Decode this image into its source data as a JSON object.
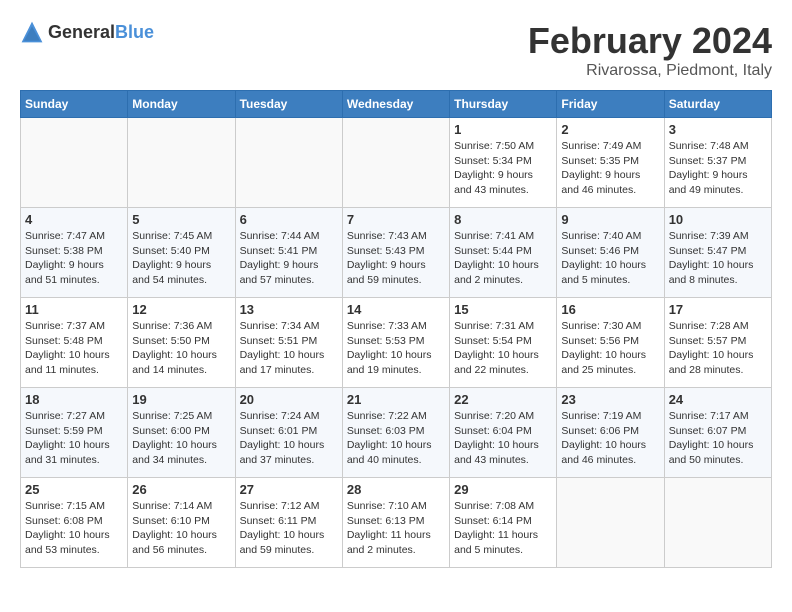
{
  "header": {
    "logo_general": "General",
    "logo_blue": "Blue",
    "month_title": "February 2024",
    "location": "Rivarossa, Piedmont, Italy"
  },
  "weekdays": [
    "Sunday",
    "Monday",
    "Tuesday",
    "Wednesday",
    "Thursday",
    "Friday",
    "Saturday"
  ],
  "weeks": [
    [
      {
        "day": "",
        "info": ""
      },
      {
        "day": "",
        "info": ""
      },
      {
        "day": "",
        "info": ""
      },
      {
        "day": "",
        "info": ""
      },
      {
        "day": "1",
        "info": "Sunrise: 7:50 AM\nSunset: 5:34 PM\nDaylight: 9 hours\nand 43 minutes."
      },
      {
        "day": "2",
        "info": "Sunrise: 7:49 AM\nSunset: 5:35 PM\nDaylight: 9 hours\nand 46 minutes."
      },
      {
        "day": "3",
        "info": "Sunrise: 7:48 AM\nSunset: 5:37 PM\nDaylight: 9 hours\nand 49 minutes."
      }
    ],
    [
      {
        "day": "4",
        "info": "Sunrise: 7:47 AM\nSunset: 5:38 PM\nDaylight: 9 hours\nand 51 minutes."
      },
      {
        "day": "5",
        "info": "Sunrise: 7:45 AM\nSunset: 5:40 PM\nDaylight: 9 hours\nand 54 minutes."
      },
      {
        "day": "6",
        "info": "Sunrise: 7:44 AM\nSunset: 5:41 PM\nDaylight: 9 hours\nand 57 minutes."
      },
      {
        "day": "7",
        "info": "Sunrise: 7:43 AM\nSunset: 5:43 PM\nDaylight: 9 hours\nand 59 minutes."
      },
      {
        "day": "8",
        "info": "Sunrise: 7:41 AM\nSunset: 5:44 PM\nDaylight: 10 hours\nand 2 minutes."
      },
      {
        "day": "9",
        "info": "Sunrise: 7:40 AM\nSunset: 5:46 PM\nDaylight: 10 hours\nand 5 minutes."
      },
      {
        "day": "10",
        "info": "Sunrise: 7:39 AM\nSunset: 5:47 PM\nDaylight: 10 hours\nand 8 minutes."
      }
    ],
    [
      {
        "day": "11",
        "info": "Sunrise: 7:37 AM\nSunset: 5:48 PM\nDaylight: 10 hours\nand 11 minutes."
      },
      {
        "day": "12",
        "info": "Sunrise: 7:36 AM\nSunset: 5:50 PM\nDaylight: 10 hours\nand 14 minutes."
      },
      {
        "day": "13",
        "info": "Sunrise: 7:34 AM\nSunset: 5:51 PM\nDaylight: 10 hours\nand 17 minutes."
      },
      {
        "day": "14",
        "info": "Sunrise: 7:33 AM\nSunset: 5:53 PM\nDaylight: 10 hours\nand 19 minutes."
      },
      {
        "day": "15",
        "info": "Sunrise: 7:31 AM\nSunset: 5:54 PM\nDaylight: 10 hours\nand 22 minutes."
      },
      {
        "day": "16",
        "info": "Sunrise: 7:30 AM\nSunset: 5:56 PM\nDaylight: 10 hours\nand 25 minutes."
      },
      {
        "day": "17",
        "info": "Sunrise: 7:28 AM\nSunset: 5:57 PM\nDaylight: 10 hours\nand 28 minutes."
      }
    ],
    [
      {
        "day": "18",
        "info": "Sunrise: 7:27 AM\nSunset: 5:59 PM\nDaylight: 10 hours\nand 31 minutes."
      },
      {
        "day": "19",
        "info": "Sunrise: 7:25 AM\nSunset: 6:00 PM\nDaylight: 10 hours\nand 34 minutes."
      },
      {
        "day": "20",
        "info": "Sunrise: 7:24 AM\nSunset: 6:01 PM\nDaylight: 10 hours\nand 37 minutes."
      },
      {
        "day": "21",
        "info": "Sunrise: 7:22 AM\nSunset: 6:03 PM\nDaylight: 10 hours\nand 40 minutes."
      },
      {
        "day": "22",
        "info": "Sunrise: 7:20 AM\nSunset: 6:04 PM\nDaylight: 10 hours\nand 43 minutes."
      },
      {
        "day": "23",
        "info": "Sunrise: 7:19 AM\nSunset: 6:06 PM\nDaylight: 10 hours\nand 46 minutes."
      },
      {
        "day": "24",
        "info": "Sunrise: 7:17 AM\nSunset: 6:07 PM\nDaylight: 10 hours\nand 50 minutes."
      }
    ],
    [
      {
        "day": "25",
        "info": "Sunrise: 7:15 AM\nSunset: 6:08 PM\nDaylight: 10 hours\nand 53 minutes."
      },
      {
        "day": "26",
        "info": "Sunrise: 7:14 AM\nSunset: 6:10 PM\nDaylight: 10 hours\nand 56 minutes."
      },
      {
        "day": "27",
        "info": "Sunrise: 7:12 AM\nSunset: 6:11 PM\nDaylight: 10 hours\nand 59 minutes."
      },
      {
        "day": "28",
        "info": "Sunrise: 7:10 AM\nSunset: 6:13 PM\nDaylight: 11 hours\nand 2 minutes."
      },
      {
        "day": "29",
        "info": "Sunrise: 7:08 AM\nSunset: 6:14 PM\nDaylight: 11 hours\nand 5 minutes."
      },
      {
        "day": "",
        "info": ""
      },
      {
        "day": "",
        "info": ""
      }
    ]
  ]
}
